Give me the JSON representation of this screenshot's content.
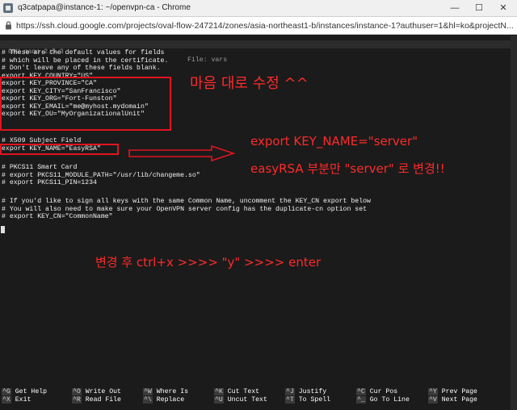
{
  "window": {
    "title": "q3catpapa@instance-1: ~/openvpn-ca - Chrome",
    "minimize": "—",
    "maximize": "☐",
    "close": "✕"
  },
  "address": {
    "url": "https://ssh.cloud.google.com/projects/oval-flow-247214/zones/asia-northeast1-b/instances/instance-1?authuser=1&hl=ko&projectN..."
  },
  "nano": {
    "version": "GNU nano 2.5.3",
    "file": "File: vars"
  },
  "editor_lines": [
    "# These are the default values for fields",
    "# which will be placed in the certificate.",
    "# Don't leave any of these fields blank.",
    "export KEY_COUNTRY=\"US\"",
    "export KEY_PROVINCE=\"CA\"",
    "export KEY_CITY=\"SanFrancisco\"",
    "export KEY_ORG=\"Fort-Funston\"",
    "export KEY_EMAIL=\"me@myhost.mydomain\"",
    "export KEY_OU=\"MyOrganizationalUnit\"",
    "",
    "# X509 Subject Field",
    "export KEY_NAME=\"EasyRSA\"",
    "",
    "# PKCS11 Smart Card",
    "# export PKCS11_MODULE_PATH=\"/usr/lib/changeme.so\"",
    "# export PKCS11_PIN=1234",
    "",
    "# If you'd like to sign all keys with the same Common Name, uncomment the KEY_CN export below",
    "# You will also need to make sure your OpenVPN server config has the duplicate-cn option set",
    "# export KEY_CN=\"CommonName\""
  ],
  "annotations": {
    "edit_freely": "마음 대로 수정 ^^",
    "key_name_line": "export KEY_NAME=\"server\"",
    "change_note": "easyRSA 부분만 \"server\" 로 변경!!",
    "save_note": "변경 후 ctrl+x  >>>> \"y\" >>>> enter"
  },
  "shortcuts": [
    {
      "key": "^G",
      "label": "Get Help"
    },
    {
      "key": "^X",
      "label": "Exit"
    },
    {
      "key": "^O",
      "label": "Write Out"
    },
    {
      "key": "^R",
      "label": "Read File"
    },
    {
      "key": "^W",
      "label": "Where Is"
    },
    {
      "key": "^\\",
      "label": "Replace"
    },
    {
      "key": "^K",
      "label": "Cut Text"
    },
    {
      "key": "^U",
      "label": "Uncut Text"
    },
    {
      "key": "^J",
      "label": "Justify"
    },
    {
      "key": "^T",
      "label": "To Spell"
    },
    {
      "key": "^C",
      "label": "Cur Pos"
    },
    {
      "key": "^_",
      "label": "Go To Line"
    },
    {
      "key": "^Y",
      "label": "Prev Page"
    },
    {
      "key": "^V",
      "label": "Next Page"
    }
  ],
  "colors": {
    "annotation_red": "#e0141e",
    "terminal_bg": "#1b1b1b"
  }
}
